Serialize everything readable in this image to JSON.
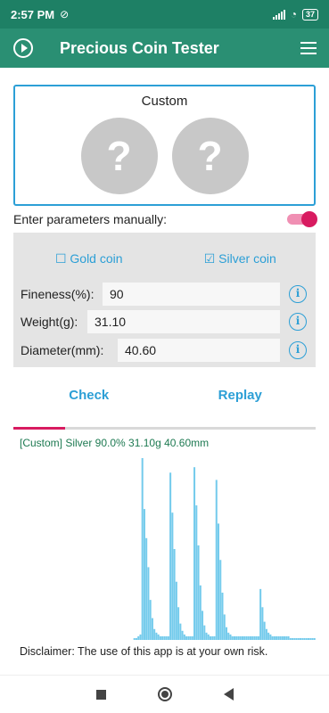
{
  "status_bar": {
    "time": "2:57 PM",
    "battery": "37"
  },
  "app_bar": {
    "title": "Precious Coin Tester"
  },
  "coin_box": {
    "label": "Custom",
    "placeholder_glyph": "?"
  },
  "manual": {
    "label": "Enter parameters manually:",
    "enabled": true
  },
  "coin_type": {
    "gold_label": "☐ Gold coin",
    "silver_label": "☑ Silver coin",
    "selected": "silver"
  },
  "params": [
    {
      "label": "Fineness(%):",
      "value": "90"
    },
    {
      "label": "Weight(g):",
      "value": "31.10"
    },
    {
      "label": "Diameter(mm):",
      "value": "40.60"
    }
  ],
  "info_glyph": "i",
  "actions": {
    "check": "Check",
    "replay": "Replay"
  },
  "progress": {
    "fraction": 0.17
  },
  "result": {
    "text": "[Custom] Silver 90.0% 31.10g 40.60mm"
  },
  "chart_data": {
    "type": "bar",
    "description_color": "#74cbec",
    "values": [
      0,
      0,
      0,
      0,
      0,
      0,
      0,
      0,
      0,
      0,
      0,
      0,
      0,
      0,
      0,
      0,
      0,
      0,
      0,
      0,
      0,
      0,
      0,
      0,
      0,
      0,
      0,
      0,
      0,
      0,
      0,
      0,
      0,
      0,
      0,
      0,
      0,
      0,
      0,
      0,
      0,
      0,
      0,
      0,
      0,
      0,
      0,
      0,
      0,
      0,
      0,
      0,
      0,
      0,
      0,
      0,
      0,
      0,
      0,
      0,
      1,
      1,
      2,
      3,
      100,
      72,
      56,
      40,
      22,
      12,
      6,
      4,
      3,
      2,
      2,
      2,
      2,
      2,
      92,
      70,
      50,
      32,
      18,
      9,
      5,
      3,
      2,
      2,
      2,
      2,
      95,
      74,
      52,
      30,
      16,
      8,
      4,
      3,
      2,
      2,
      2,
      88,
      64,
      44,
      26,
      14,
      7,
      4,
      3,
      2,
      2,
      2,
      2,
      2,
      2,
      2,
      2,
      2,
      2,
      2,
      2,
      2,
      2,
      28,
      18,
      10,
      6,
      4,
      3,
      2,
      2,
      2,
      2,
      2,
      2,
      2,
      2,
      2,
      1,
      1,
      1,
      1,
      1,
      1,
      1,
      1,
      1,
      1,
      1,
      1,
      1
    ]
  },
  "disclaimer": "Disclaimer: The use of this app is at your own risk."
}
